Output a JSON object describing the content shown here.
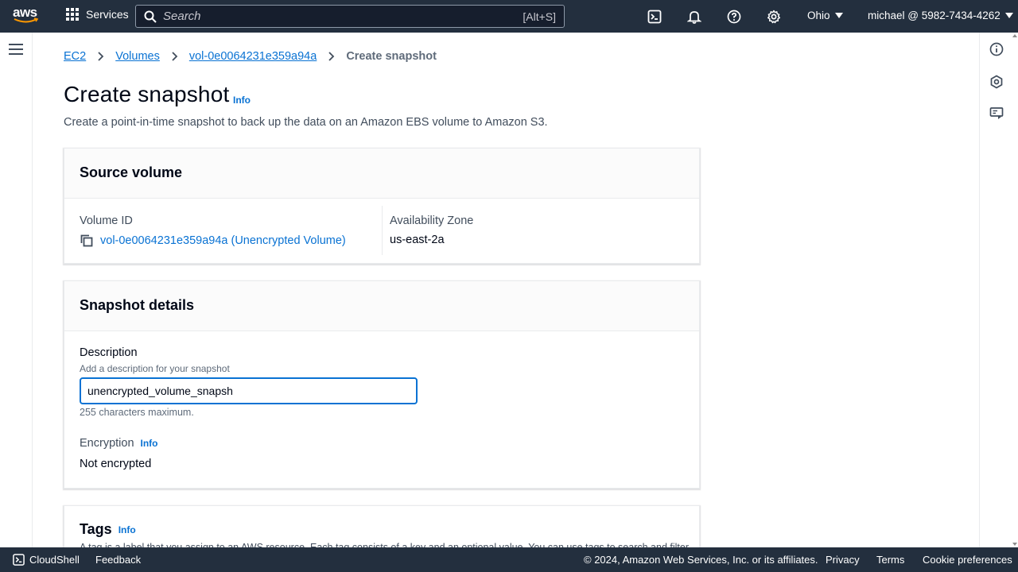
{
  "topnav": {
    "logo_text": "aws",
    "services_label": "Services",
    "search_placeholder": "Search",
    "search_shortcut": "[Alt+S]",
    "region": "Ohio",
    "account": "michael @ 5982-7434-4262"
  },
  "breadcrumb": {
    "items": [
      "EC2",
      "Volumes",
      "vol-0e0064231e359a94a"
    ],
    "current": "Create snapshot"
  },
  "page": {
    "title": "Create snapshot",
    "info": "Info",
    "description": "Create a point-in-time snapshot to back up the data on an Amazon EBS volume to Amazon S3."
  },
  "source_volume": {
    "header": "Source volume",
    "volume_id_label": "Volume ID",
    "volume_id_value": "vol-0e0064231e359a94a (Unencrypted Volume)",
    "az_label": "Availability Zone",
    "az_value": "us-east-2a"
  },
  "snapshot_details": {
    "header": "Snapshot details",
    "description_label": "Description",
    "description_hint": "Add a description for your snapshot",
    "description_value": "unencrypted_volume_snapsh",
    "description_constraint": "255 characters maximum.",
    "encryption_label": "Encryption",
    "encryption_info": "Info",
    "encryption_value": "Not encrypted"
  },
  "tags": {
    "header": "Tags",
    "info": "Info",
    "description": "A tag is a label that you assign to an AWS resource. Each tag consists of a key and an optional value. You can use tags to search and filter"
  },
  "footer": {
    "cloudshell": "CloudShell",
    "feedback": "Feedback",
    "copyright": "© 2024, Amazon Web Services, Inc. or its affiliates.",
    "privacy": "Privacy",
    "terms": "Terms",
    "cookies": "Cookie preferences"
  },
  "colors": {
    "nav_bg": "#232f3e",
    "link": "#0972d3",
    "text": "#000716"
  }
}
